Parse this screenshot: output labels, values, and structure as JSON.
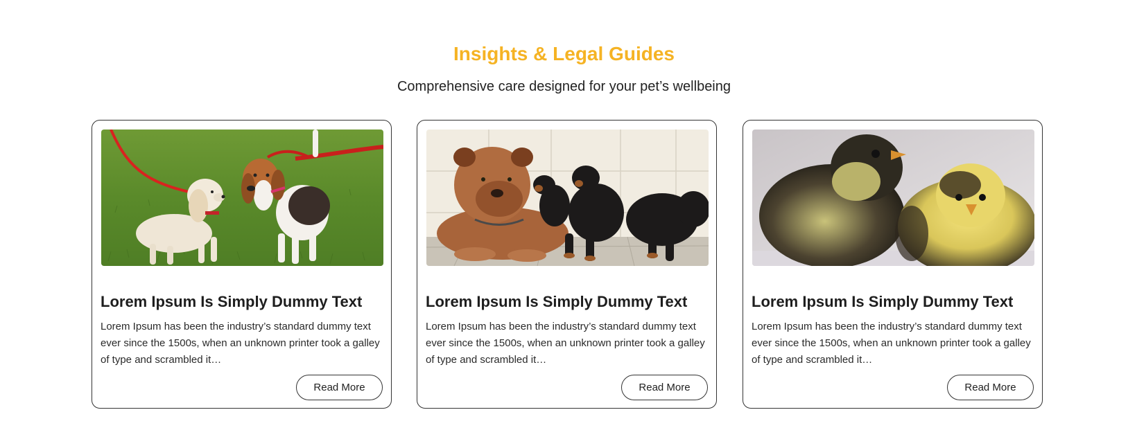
{
  "section": {
    "title": "Insights & Legal Guides",
    "subtitle": "Comprehensive care designed for your pet’s wellbeing"
  },
  "colors": {
    "accent": "#F5B324",
    "text": "#222222",
    "border": "#333333"
  },
  "cards": [
    {
      "image_subject": "two-puppies-on-leashes-on-grass",
      "title": "Lorem Ipsum Is Simply Dummy Text",
      "excerpt": "Lorem Ipsum has been the industry’s standard dummy text ever since the 1500s, when an unknown printer took a galley of type and scrambled it…",
      "button_label": "Read More"
    },
    {
      "image_subject": "mastiff-with-black-puppies",
      "title": "Lorem Ipsum Is Simply Dummy Text",
      "excerpt": "Lorem Ipsum has been the industry’s standard dummy text ever since the 1500s, when an unknown printer took a galley of type and scrambled it…",
      "button_label": "Read More"
    },
    {
      "image_subject": "two-baby-chicks",
      "title": "Lorem Ipsum Is Simply Dummy Text",
      "excerpt": "Lorem Ipsum has been the industry’s standard dummy text ever since the 1500s, when an unknown printer took a galley of type and scrambled it…",
      "button_label": "Read More"
    }
  ]
}
